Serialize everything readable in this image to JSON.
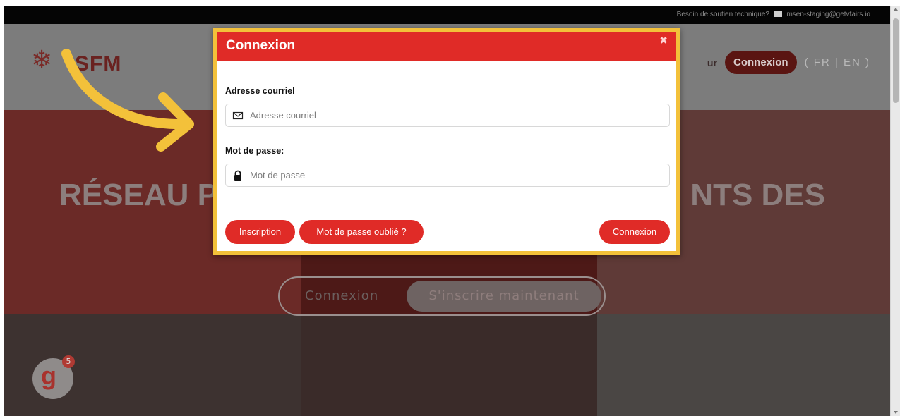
{
  "topbar": {
    "support_text": "Besoin de soutien technique?",
    "support_email": "msen-staging@getvfairs.io"
  },
  "header": {
    "logo_text": "SFM",
    "nav_fragment": "ur",
    "login_button": "Connexion",
    "lang_switch": "( FR | EN )"
  },
  "hero": {
    "title_left": "RÉSEAU P",
    "title_right": "NTS DES",
    "login_label": "Connexion",
    "signup_label": "S'inscrire maintenant"
  },
  "widget": {
    "letter": "g",
    "badge": "5"
  },
  "modal": {
    "title": "Connexion",
    "close_icon": "close-icon",
    "email_label": "Adresse courriel",
    "email_placeholder": "Adresse courriel",
    "email_icon": "envelope-icon",
    "password_label": "Mot de passe:",
    "password_placeholder": "Mot de passe",
    "password_icon": "lock-icon",
    "register_button": "Inscription",
    "forgot_button": "Mot de passe oublié ?",
    "submit_button": "Connexion"
  },
  "colors": {
    "brand_red": "#e02b27",
    "highlight_yellow": "#f3c13a"
  }
}
